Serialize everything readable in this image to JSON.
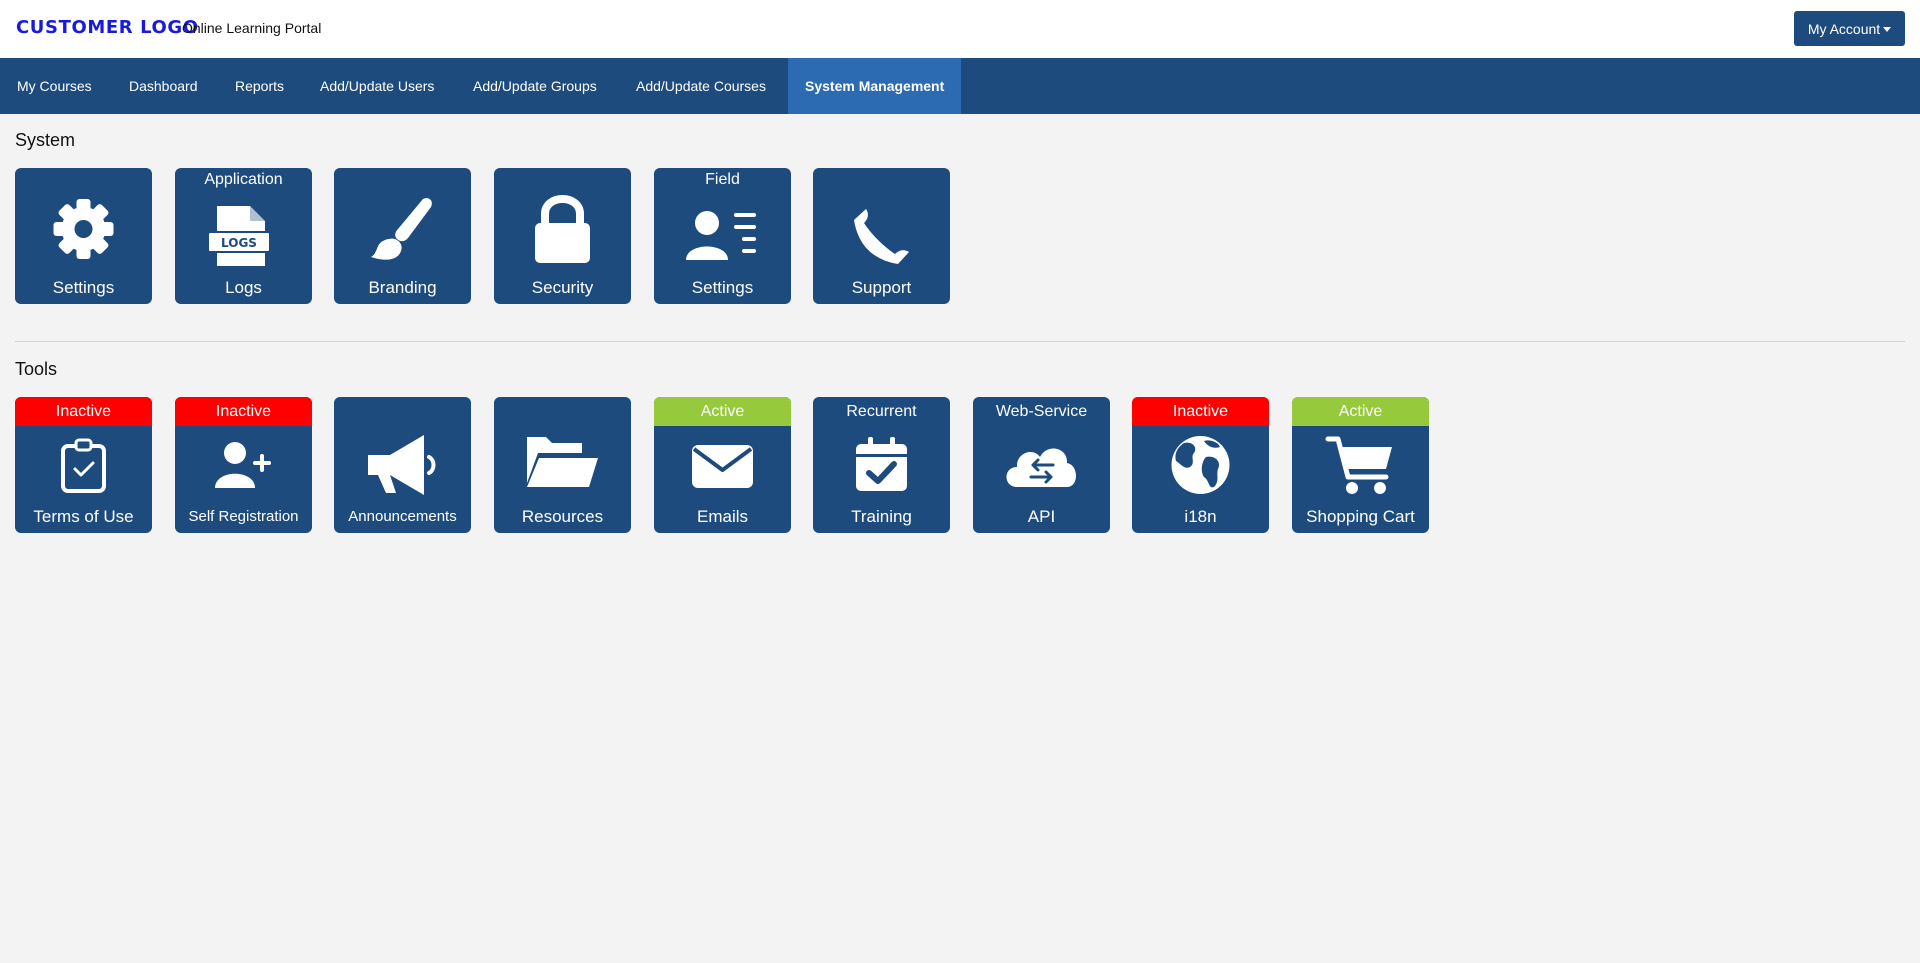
{
  "header": {
    "logo": "CUSTOMER LOGO",
    "portal_name": "Online Learning Portal",
    "account_button": "My Account"
  },
  "nav": {
    "items": [
      "My Courses",
      "Dashboard",
      "Reports",
      "Add/Update Users",
      "Add/Update Groups",
      "Add/Update Courses",
      "System Management"
    ],
    "active": "System Management"
  },
  "system": {
    "title": "System",
    "tiles": [
      {
        "top": "",
        "label": "Settings",
        "icon": "gear-icon"
      },
      {
        "top": "Application",
        "label": "Logs",
        "icon": "logs-file-icon",
        "icon_text": "LOGS"
      },
      {
        "top": "",
        "label": "Branding",
        "icon": "paintbrush-icon"
      },
      {
        "top": "",
        "label": "Security",
        "icon": "lock-icon"
      },
      {
        "top": "Field",
        "label": "Settings",
        "icon": "user-list-icon"
      },
      {
        "top": "",
        "label": "Support",
        "icon": "phone-icon"
      }
    ]
  },
  "tools": {
    "title": "Tools",
    "tiles": [
      {
        "status": "Inactive",
        "label": "Terms of Use",
        "icon": "clipboard-check-icon"
      },
      {
        "status": "Inactive",
        "label": "Self Registration",
        "icon": "user-plus-icon"
      },
      {
        "status": "",
        "label": "Announcements",
        "icon": "megaphone-icon"
      },
      {
        "status": "",
        "label": "Resources",
        "icon": "folder-open-icon"
      },
      {
        "status": "Active",
        "label": "Emails",
        "icon": "envelope-icon"
      },
      {
        "status": "Recurrent",
        "label": "Training",
        "icon": "calendar-check-icon"
      },
      {
        "status": "Web-Service",
        "label": "API",
        "icon": "cloud-exchange-icon"
      },
      {
        "status": "Inactive",
        "label": "i18n",
        "icon": "globe-icon"
      },
      {
        "status": "Active",
        "label": "Shopping Cart",
        "icon": "cart-icon"
      }
    ]
  },
  "colors": {
    "brand_blue": "#1d4b7e",
    "nav_active": "#2c6ab2",
    "logo_text": "#1a1adb",
    "inactive": "#ff0000",
    "active": "#97c93d",
    "background": "#f3f3f3"
  }
}
